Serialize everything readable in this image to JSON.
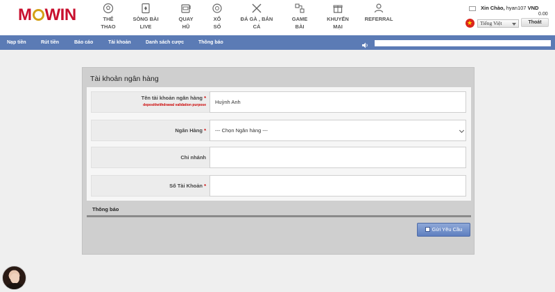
{
  "header": {
    "logo": {
      "part1": "M",
      "part2": "WIN"
    },
    "nav": [
      {
        "line1": "THỂ",
        "line2": "THAO",
        "icon": "soccer-ball-icon"
      },
      {
        "line1": "SÒNG BÀI",
        "line2": "LIVE",
        "icon": "card-icon"
      },
      {
        "line1": "QUAY",
        "line2": "HŨ",
        "icon": "slot-machine-icon"
      },
      {
        "line1": "XỔ",
        "line2": "SỐ",
        "icon": "lottery-icon"
      },
      {
        "line1": "ĐÁ GÀ , BẮN",
        "line2": "CÁ",
        "icon": "crossed-swords-icon"
      },
      {
        "line1": "GAME",
        "line2": "BÀI",
        "icon": "game-icon"
      },
      {
        "line1": "KHUYẾN",
        "line2": "MẠI",
        "icon": "gift-icon"
      },
      {
        "line1": "REFERRAL",
        "line2": "",
        "icon": "users-icon"
      }
    ],
    "user": {
      "greeting": "Xin Chào,",
      "username": "hyan107",
      "currency": "VND",
      "balance": "0.00",
      "language": "Tiếng Việt",
      "logout": "Thoát"
    }
  },
  "subnav": [
    "Nạp tiền",
    "Rút tiền",
    "Báo cáo",
    "Tài khoản",
    "Danh sách cược",
    "Thông báo"
  ],
  "panel": {
    "title": "Tài khoản ngân hàng",
    "fields": {
      "account_name": {
        "label": "Tên tài khoản ngân hàng",
        "required": "*",
        "hint": "deposit/withdrawal validation purpose",
        "value": "Huỳnh Anh"
      },
      "bank": {
        "label": "Ngân Hàng",
        "required": "*",
        "value": "--- Chọn Ngân hàng ---"
      },
      "branch": {
        "label": "Chi nhánh",
        "value": ""
      },
      "account_number": {
        "label": "Số Tài Khoản",
        "required": "*",
        "value": ""
      }
    },
    "notice_label": "Thông báo",
    "submit": "Gửi Yêu Cầu"
  },
  "colors": {
    "brand": "#c8102e",
    "subnav": "#5b7bb5",
    "button": "#6a8ac8",
    "required": "#cc0000"
  }
}
